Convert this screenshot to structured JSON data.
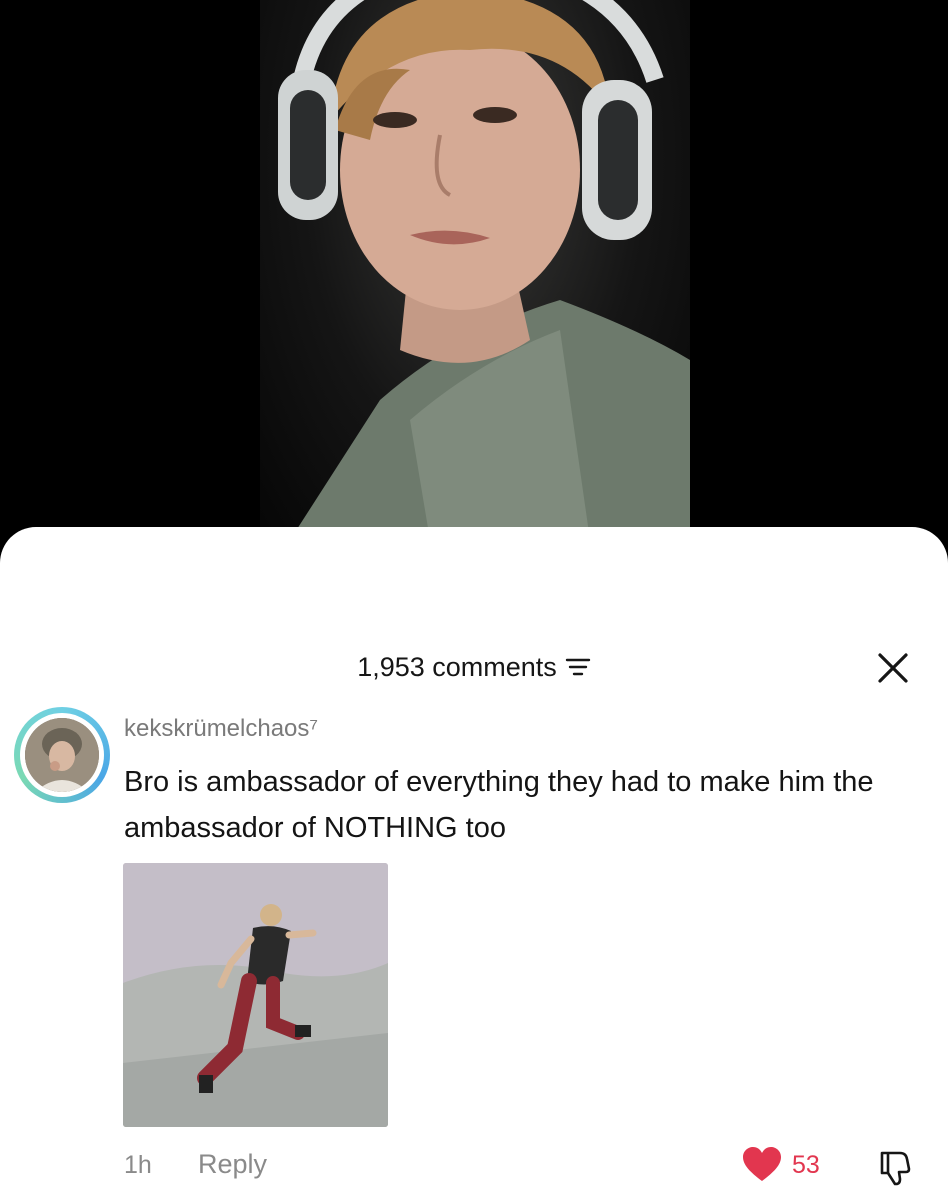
{
  "comments_panel": {
    "count_label": "1,953 comments"
  },
  "comment": {
    "username": "kekskrümelchaos⁷",
    "text": "Bro is ambassador of everything they had to make him the ambassador of NOTHING too",
    "time": "1h",
    "reply_label": "Reply",
    "like_count": "53"
  },
  "colors": {
    "like_heart": "#e2364f",
    "avatar_ring": "#4aa6e6"
  },
  "icons": {
    "filter": "filter-icon",
    "close": "close-icon",
    "heart": "heart-icon",
    "dislike": "thumbs-down-icon"
  }
}
